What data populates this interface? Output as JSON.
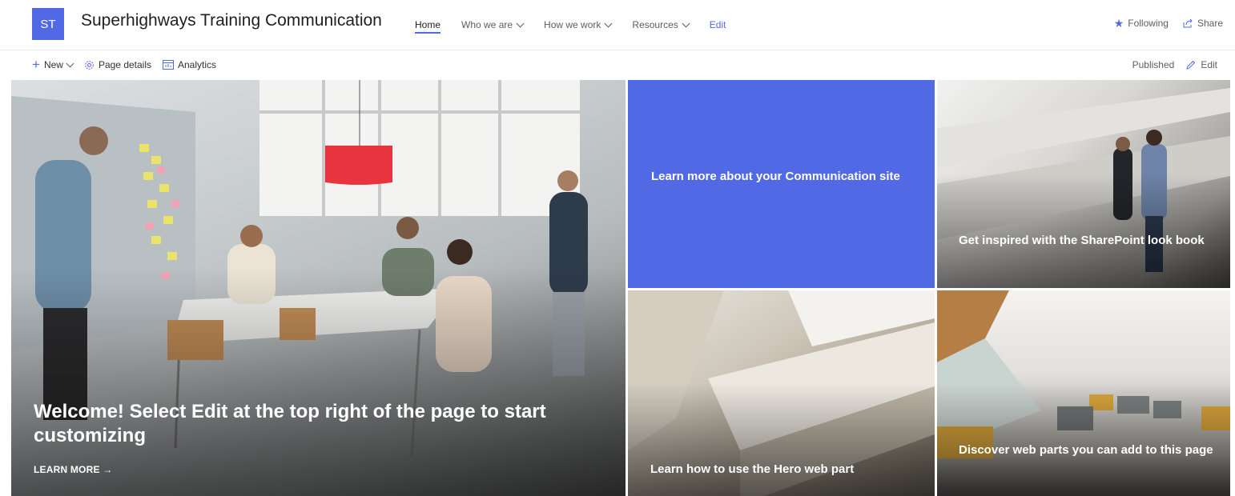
{
  "header": {
    "logo_initials": "ST",
    "site_title": "Superhighways Training Communication",
    "nav": [
      {
        "label": "Home"
      },
      {
        "label": "Who we are"
      },
      {
        "label": "How we work"
      },
      {
        "label": "Resources"
      },
      {
        "label": "Edit"
      }
    ],
    "following_label": "Following",
    "share_label": "Share"
  },
  "commandbar": {
    "new_label": "New",
    "page_details_label": "Page details",
    "analytics_label": "Analytics",
    "status_label": "Published",
    "edit_label": "Edit"
  },
  "hero": {
    "main_caption": "Welcome! Select Edit at the top right of the page to start customizing",
    "learn_more_label": "LEARN MORE →",
    "tile_blue_caption": "Learn more about your Communication site",
    "tile_stairs_caption": "Get inspired with the SharePoint look book",
    "tile_arch_caption": "Learn how to use the Hero web part",
    "tile_lobby_caption": "Discover web parts you can add to this page"
  },
  "colors": {
    "accent": "#5269e6"
  },
  "icons": {
    "new": "plus-icon",
    "page_details": "gear-icon",
    "analytics": "analytics-icon",
    "following": "star-icon",
    "share": "share-icon",
    "edit": "pencil-icon"
  }
}
